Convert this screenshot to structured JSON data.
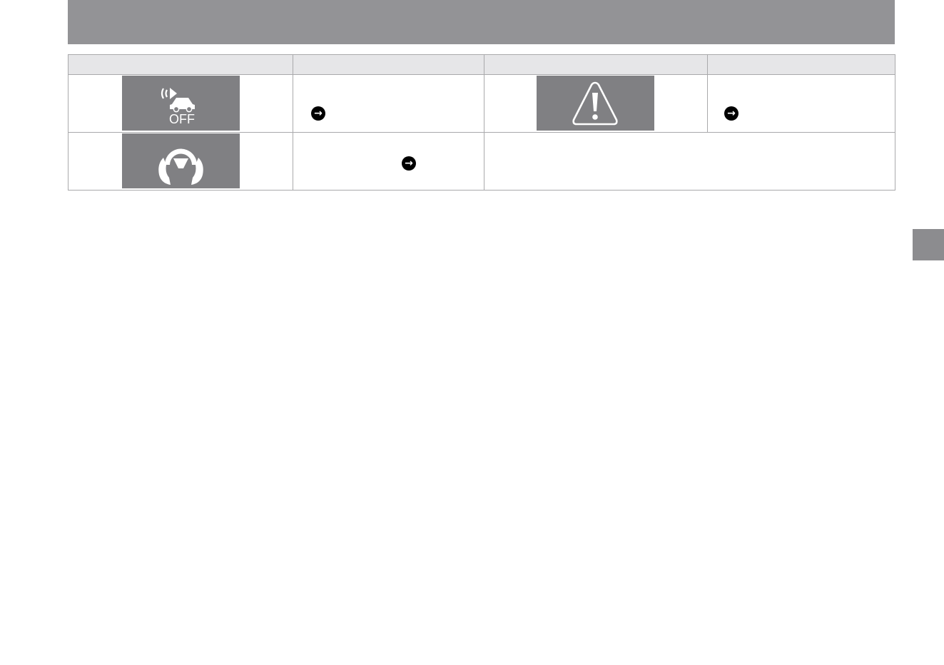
{
  "header": {
    "title": ""
  },
  "side_tab": {
    "label": ""
  },
  "table": {
    "columns": [
      "",
      "",
      "",
      ""
    ],
    "rows": [
      {
        "lamp_left": {
          "icon": "forward-collision-off-icon",
          "text": "OFF"
        },
        "desc_left": {
          "text": "",
          "ref": ""
        },
        "lamp_right": {
          "icon": "master-warning-icon"
        },
        "desc_right": {
          "text": "",
          "ref": ""
        }
      },
      {
        "lamp_left": {
          "icon": "steering-wheel-hands-icon"
        },
        "desc_left": {
          "text": "",
          "ref": ""
        },
        "note": ""
      }
    ]
  },
  "colors": {
    "header_band": "#939396",
    "lamp_bg": "#808083",
    "table_header_bg": "#e6e6e8",
    "grid_line": "#a9a9ab"
  }
}
